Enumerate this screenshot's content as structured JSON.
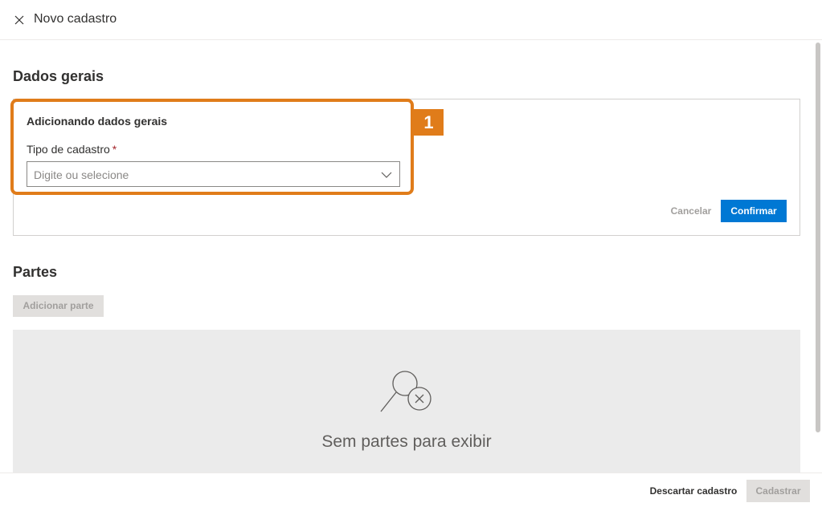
{
  "header": {
    "title": "Novo cadastro",
    "close_icon": "close-icon"
  },
  "general": {
    "section_title": "Dados gerais",
    "card_title": "Adicionando dados gerais",
    "field_label": "Tipo de cadastro",
    "required_marker": "*",
    "field_placeholder": "Digite ou selecione",
    "cancel_label": "Cancelar",
    "confirm_label": "Confirmar",
    "callout_number": "1"
  },
  "parts": {
    "section_title": "Partes",
    "add_label": "Adicionar parte",
    "empty_icon": "search-no-results-icon",
    "empty_text": "Sem partes para exibir"
  },
  "footer": {
    "discard_label": "Descartar cadastro",
    "register_label": "Cadastrar"
  },
  "colors": {
    "accent": "#0078d4",
    "highlight": "#e07c1a",
    "required": "#a4262c",
    "disabled_bg": "#e1dfdd",
    "empty_bg": "#ebebeb"
  }
}
